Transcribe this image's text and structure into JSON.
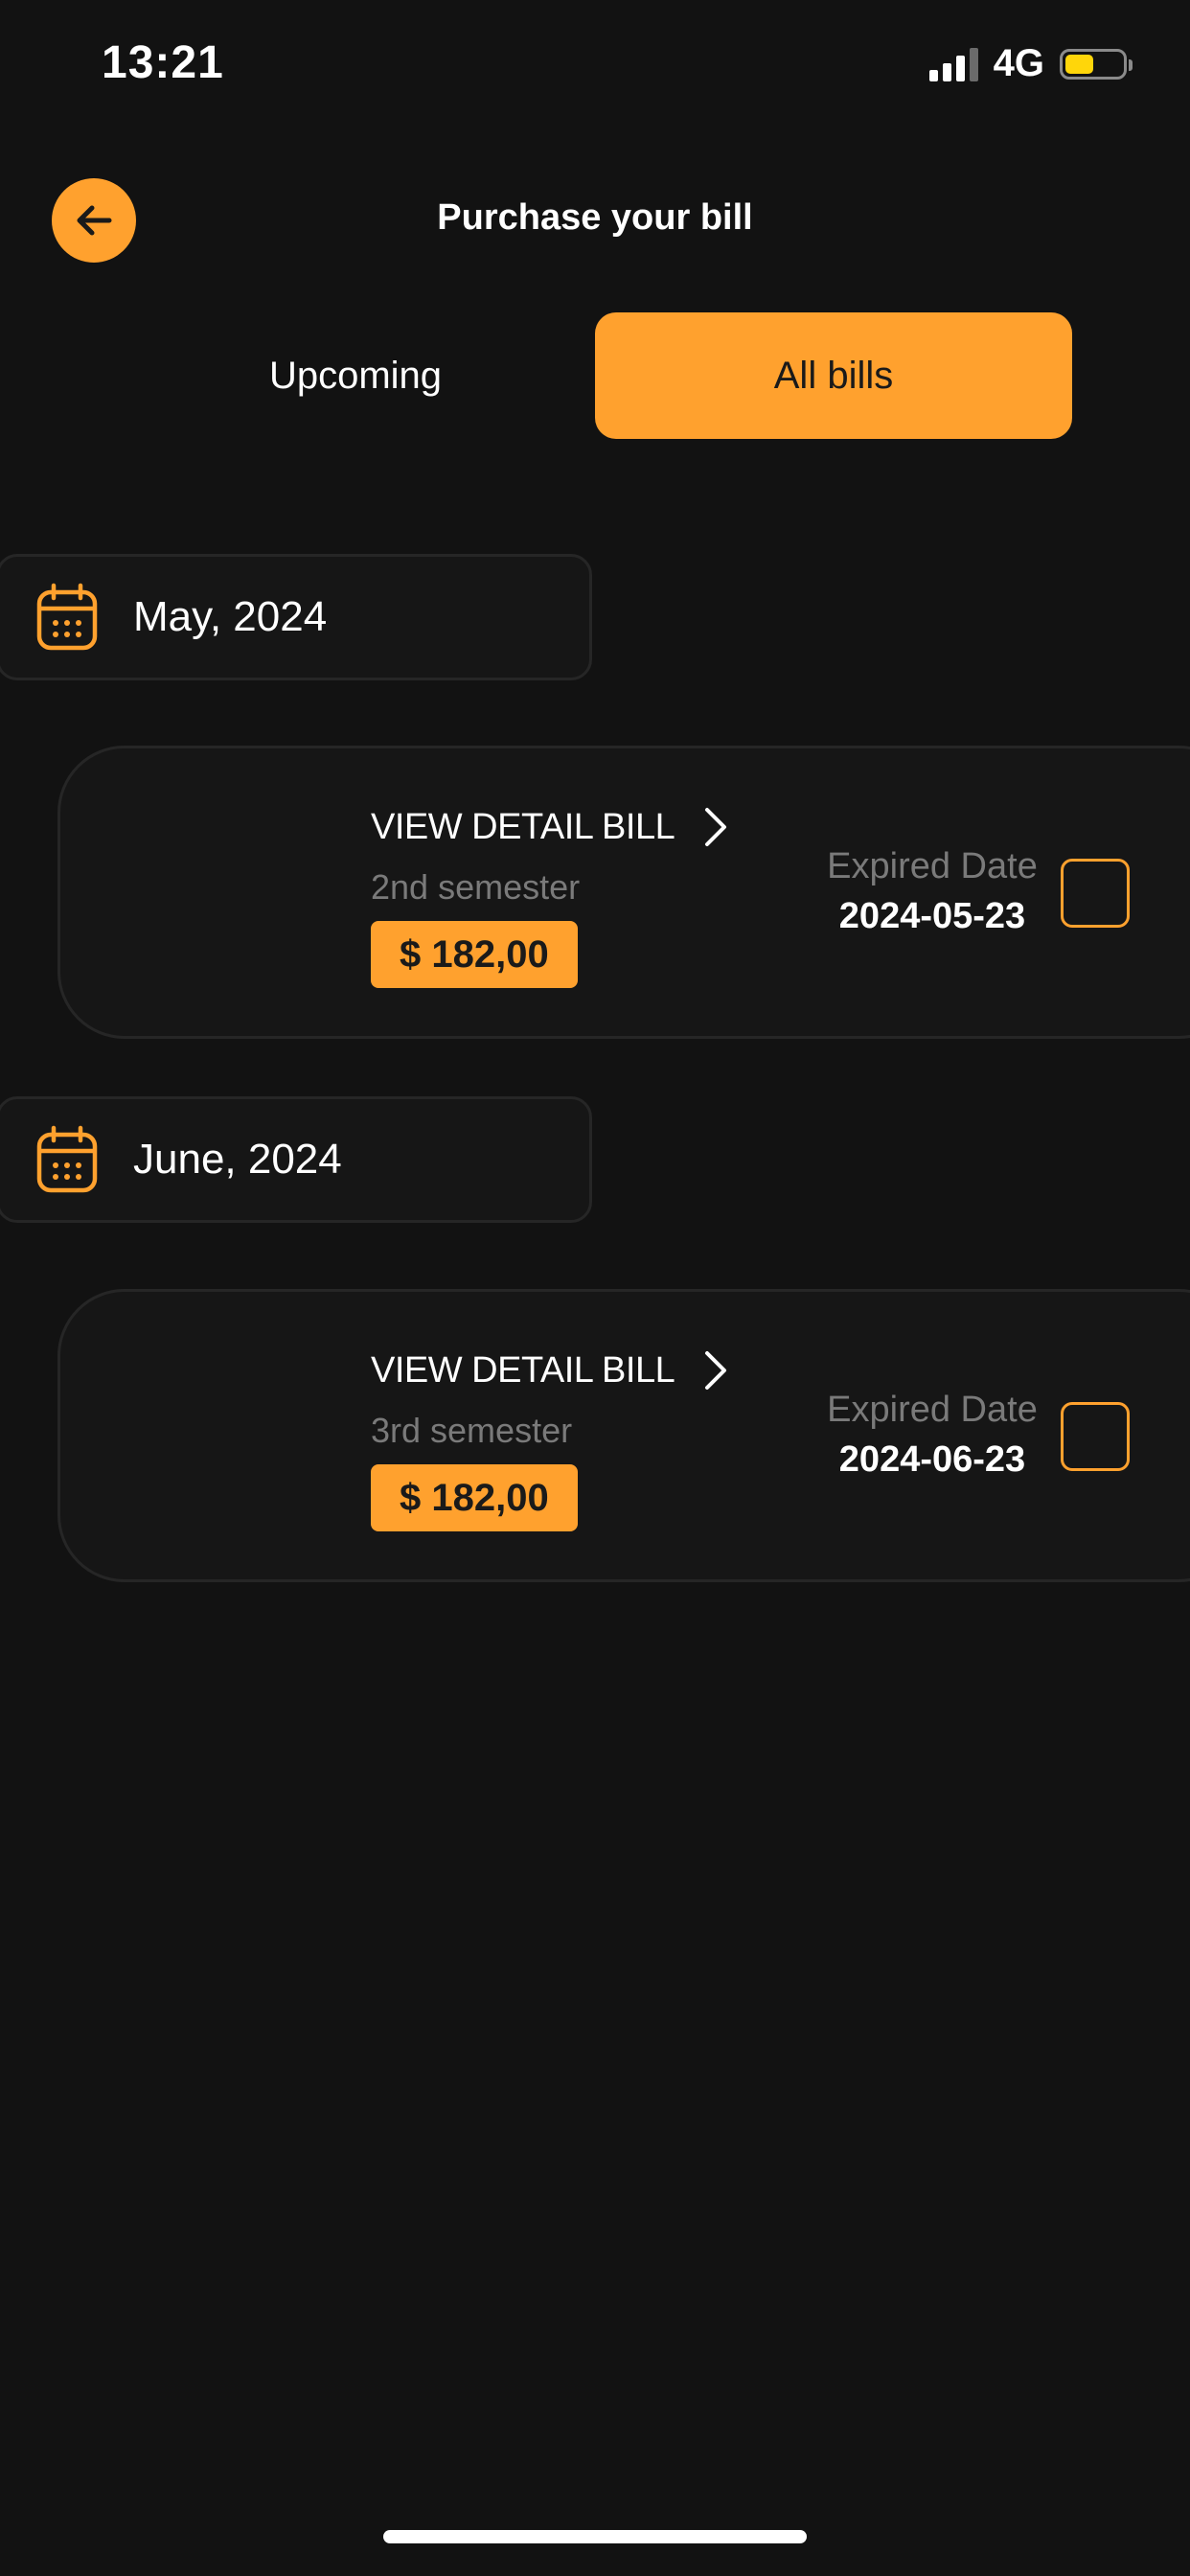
{
  "status_bar": {
    "time": "13:21",
    "network": "4G",
    "battery_level": 0.5,
    "battery_color": "#ffd60a"
  },
  "header": {
    "title": "Purchase your bill",
    "back_icon": "arrow-left-icon"
  },
  "tabs": [
    {
      "label": "Upcoming",
      "active": false
    },
    {
      "label": "All bills",
      "active": true
    }
  ],
  "colors": {
    "accent": "#ffa12e",
    "background": "#121212",
    "card": "#161616",
    "muted_text": "#7a7a7a"
  },
  "groups": [
    {
      "month": "May, 2024",
      "icon": "calendar-icon",
      "bill": {
        "detail_label": "VIEW DETAIL BILL",
        "semester": "2nd semester",
        "amount": "$ 182,00",
        "expired_label": "Expired Date",
        "expired_date": "2024-05-23",
        "checked": false
      }
    },
    {
      "month": "June, 2024",
      "icon": "calendar-icon",
      "bill": {
        "detail_label": "VIEW DETAIL BILL",
        "semester": "3rd semester",
        "amount": "$ 182,00",
        "expired_label": "Expired Date",
        "expired_date": "2024-06-23",
        "checked": false
      }
    }
  ]
}
